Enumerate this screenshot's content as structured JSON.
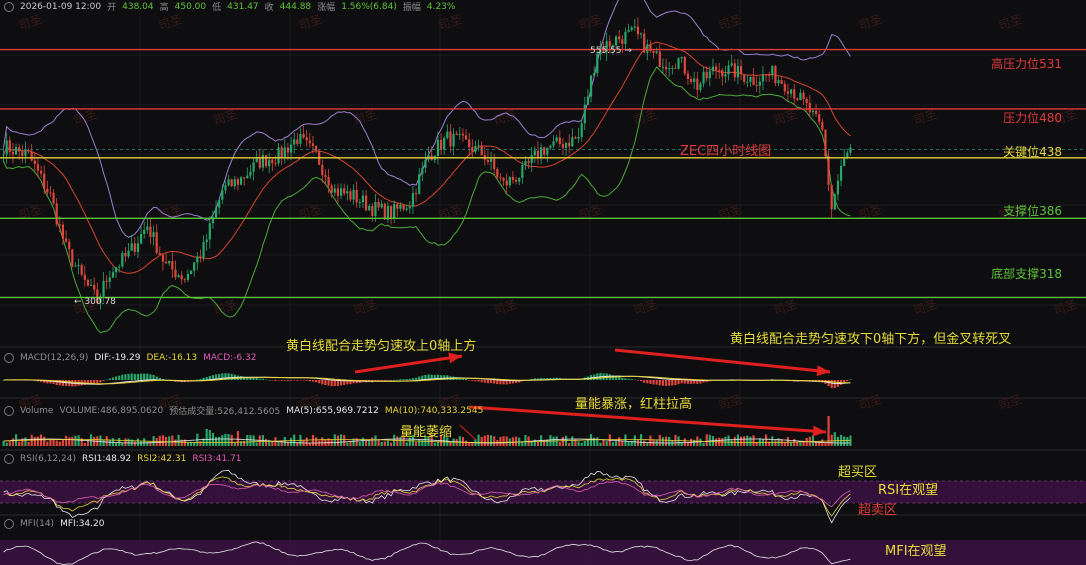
{
  "header": {
    "datetime": "2026-01-09 12:00",
    "open_label": "开",
    "open": "438.04",
    "high_label": "高",
    "high": "450.00",
    "low_label": "低",
    "low": "431.47",
    "close_label": "收",
    "close": "444.88",
    "change_label": "涨幅",
    "change": "1.56%(6.84)",
    "amp_label": "振幅",
    "amp": "4.23%"
  },
  "watermark": "司圣",
  "price_panel": {
    "title": "ZEC四小时线图",
    "high_marker": "555.55 →",
    "low_marker": "← 300.78",
    "levels": [
      {
        "label": "高压力位531",
        "value": 531,
        "color": "#e23b3b"
      },
      {
        "label": "压力位480",
        "value": 480,
        "color": "#e23b3b"
      },
      {
        "label": "关键位438",
        "value": 438,
        "color": "#e6d23a"
      },
      {
        "label": "支撑位386",
        "value": 386,
        "color": "#5ec23a"
      },
      {
        "label": "底部支撑318",
        "value": 318,
        "color": "#5ec23a"
      }
    ]
  },
  "macd_panel": {
    "name": "MACD(12,26,9)",
    "dif": "DIF:-19.29",
    "dea": "DEA:-16.13",
    "macd": "MACD:-6.32",
    "note_left": "黄白线配合走势匀速攻上0轴上方",
    "note_right": "黄白线配合走势匀速攻下0轴下方，但金叉转死叉"
  },
  "volume_panel": {
    "name": "Volume",
    "volume": "VOLUME:486,895.0620",
    "est": "预估成交量:526,412.5605",
    "ma5": "MA(5):655,969.7212",
    "ma10": "MA(10):740,333.2545",
    "note_surge": "量能暴涨，红柱拉高",
    "note_shrink": "量能萎缩"
  },
  "rsi_panel": {
    "name": "RSI(6,12,24)",
    "rsi1": "RSI1:48.92",
    "rsi2": "RSI2:42.31",
    "rsi3": "RSI3:41.71",
    "overbought": "超买区",
    "watch": "RSI在观望",
    "oversold": "超卖区"
  },
  "mfi_panel": {
    "name": "MFI(14)",
    "mfi": "MFI:34.20",
    "watch": "MFI在观望"
  },
  "chart_data": {
    "type": "candlestick",
    "ylim": [
      290,
      565
    ],
    "price_high": 555.55,
    "price_low": 300.78,
    "close_keypoints": [
      [
        0,
        448
      ],
      [
        8,
        440
      ],
      [
        15,
        405
      ],
      [
        20,
        360
      ],
      [
        25,
        335
      ],
      [
        30,
        315
      ],
      [
        34,
        340
      ],
      [
        40,
        355
      ],
      [
        46,
        380
      ],
      [
        52,
        345
      ],
      [
        58,
        335
      ],
      [
        64,
        360
      ],
      [
        70,
        410
      ],
      [
        76,
        420
      ],
      [
        82,
        435
      ],
      [
        88,
        440
      ],
      [
        94,
        455
      ],
      [
        100,
        440
      ],
      [
        106,
        410
      ],
      [
        112,
        405
      ],
      [
        118,
        395
      ],
      [
        124,
        390
      ],
      [
        130,
        400
      ],
      [
        136,
        440
      ],
      [
        142,
        455
      ],
      [
        148,
        450
      ],
      [
        154,
        440
      ],
      [
        160,
        415
      ],
      [
        166,
        425
      ],
      [
        172,
        445
      ],
      [
        178,
        450
      ],
      [
        184,
        455
      ],
      [
        190,
        530
      ],
      [
        196,
        540
      ],
      [
        202,
        545
      ],
      [
        208,
        525
      ],
      [
        212,
        520
      ],
      [
        216,
        522
      ],
      [
        222,
        500
      ],
      [
        228,
        515
      ],
      [
        234,
        512
      ],
      [
        240,
        505
      ],
      [
        246,
        510
      ],
      [
        252,
        498
      ],
      [
        258,
        478
      ],
      [
        262,
        460
      ],
      [
        265,
        395
      ],
      [
        268,
        430
      ],
      [
        271,
        445
      ]
    ],
    "candle_count": 272
  }
}
